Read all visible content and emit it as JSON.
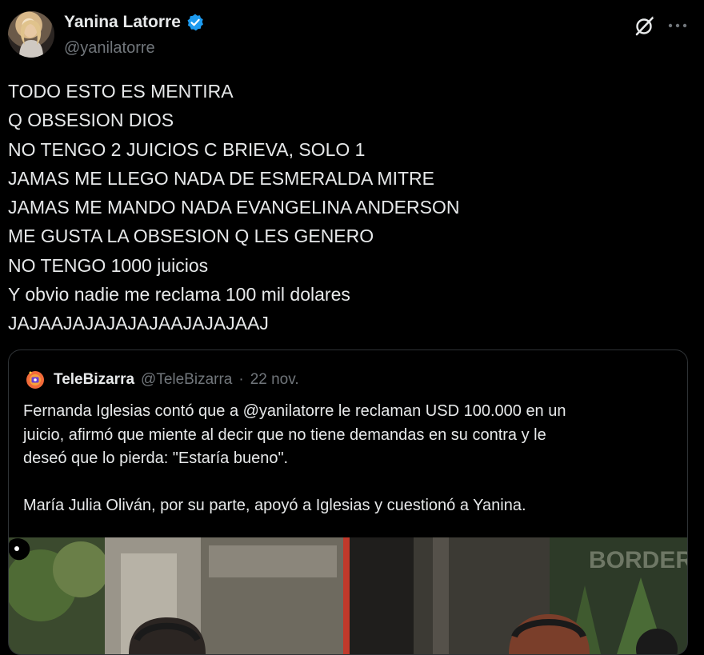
{
  "author": {
    "name": "Yanina Latorre",
    "handle": "@yanilatorre",
    "verified": true,
    "avatar_icon": "profile-photo"
  },
  "actions": {
    "grok_icon": "grok-icon",
    "more_icon": "more-options-icon"
  },
  "tweet": {
    "lines": [
      "TODO ESTO ES MENTIRA",
      "Q OBSESION DIOS",
      "NO TENGO 2 JUICIOS C BRIEVA, SOLO 1",
      "JAMAS ME LLEGO NADA DE ESMERALDA MITRE",
      "JAMAS ME MANDO NADA EVANGELINA ANDERSON",
      "ME GUSTA LA OBSESION Q LES GENERO",
      "NO TENGO 1000 juicios",
      "Y obvio nadie me reclama 100 mil dolares",
      "JAJAAJAJAJAJAJAAJAJAJAAJ"
    ]
  },
  "quote": {
    "name": "TeleBizarra",
    "handle": "@TeleBizarra",
    "separator": "·",
    "date": "22 nov.",
    "paragraph1": [
      "Fernanda Iglesias contó que a @yanilatorre le reclaman USD 100.000 en un",
      "juicio, afirmó que miente al decir que no tiene demandas en su contra y le",
      "deseó que lo pierda: \"Estaría bueno\"."
    ],
    "paragraph2": [
      "María Julia Oliván, por su parte, apoyó a Iglesias y cuestionó a Yanina."
    ],
    "media_watermark": "BORDER"
  },
  "colors": {
    "background": "#000000",
    "text": "#e7e9ea",
    "secondary": "#71767b",
    "verified": "#1d9bf0",
    "border": "#2f3336"
  }
}
